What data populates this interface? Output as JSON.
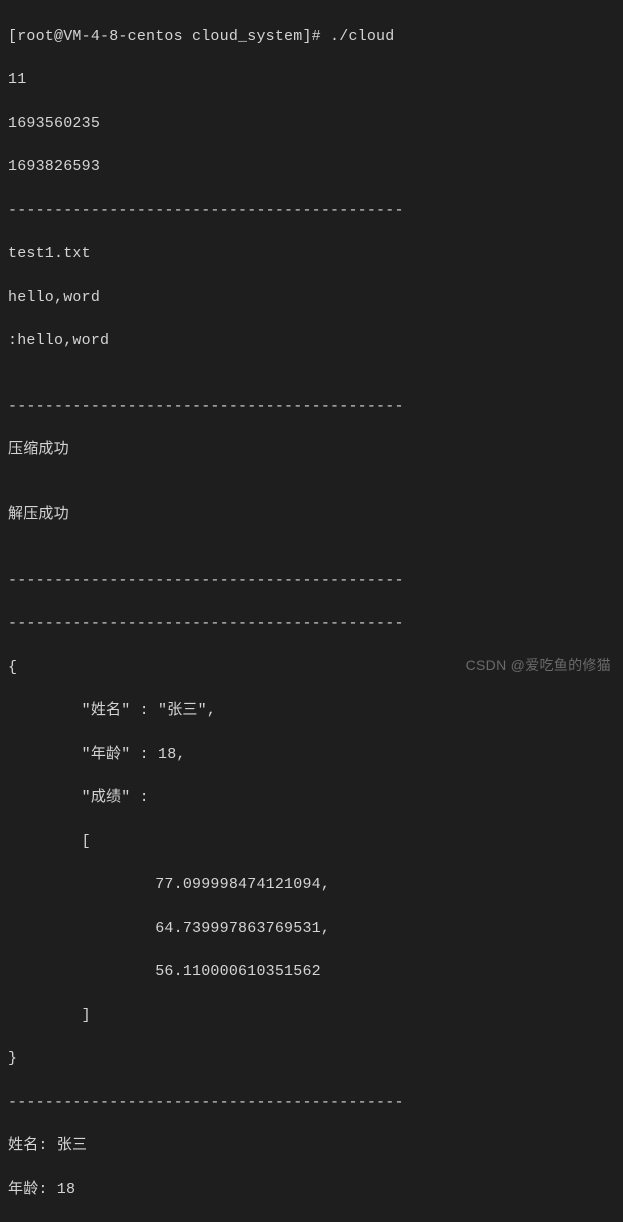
{
  "terminal": {
    "prompt_line": "[root@VM-4-8-centos cloud_system]# ./cloud",
    "line_11": "11",
    "ts1": "1693560235",
    "ts2": "1693826593",
    "dash1": "-------------------------------------------",
    "filename": "test1.txt",
    "hello1": "hello,word",
    "hello2": ":hello,word",
    "blank": "",
    "dash2": "-------------------------------------------",
    "compress_ok": "压缩成功",
    "decompress_ok": "解压成功",
    "dash3": "-------------------------------------------",
    "dash4": "-------------------------------------------",
    "json_open": "{",
    "json_name": "        \"姓名\" : \"张三\",",
    "json_age": "        \"年龄\" : 18,",
    "json_score_key": "        \"成绩\" : ",
    "json_arr_open": "        [",
    "json_val1": "                77.099998474121094,",
    "json_val2": "                64.739997863769531,",
    "json_val3": "                56.110000610351562",
    "json_arr_close": "        ]",
    "json_close": "}",
    "dash5": "-------------------------------------------",
    "out_name": "姓名: 张三",
    "out_age": "年龄: 18"
  },
  "watermark": "CSDN @爱吃鱼的修猫"
}
